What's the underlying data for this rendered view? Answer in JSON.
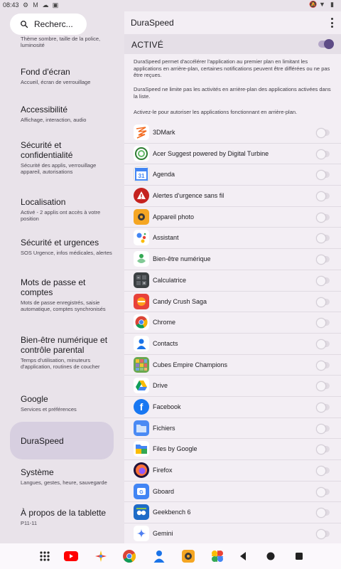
{
  "status_bar": {
    "time": "08:43",
    "left_icons": [
      "gear-icon",
      "gmail-icon",
      "cloud-icon",
      "image-icon"
    ],
    "right_icons": [
      "mute-icon",
      "wifi-icon",
      "battery-icon"
    ]
  },
  "search": {
    "placeholder": "Recherc..."
  },
  "categories": [
    {
      "title": "",
      "sub": "Thème sombre, taille de la police, luminosité"
    },
    {
      "title": "Fond d'écran",
      "sub": "Accueil, écran de verrouillage"
    },
    {
      "title": "Accessibilité",
      "sub": "Affichage, interaction, audio"
    },
    {
      "title": "Sécurité et confidentialité",
      "sub": "Sécurité des applis, verrouillage appareil, autorisations"
    },
    {
      "title": "Localisation",
      "sub": "Activé - 2 applis ont accès à votre position"
    },
    {
      "title": "Sécurité et urgences",
      "sub": "SOS Urgence, infos médicales, alertes"
    },
    {
      "title": "Mots de passe et comptes",
      "sub": "Mots de passe enregistrés, saisie automatique, comptes synchronisés"
    },
    {
      "title": "Bien-être numérique et contrôle parental",
      "sub": "Temps d'utilisation, minuteurs d'application, routines de coucher"
    },
    {
      "title": "Google",
      "sub": "Services et préférences"
    },
    {
      "title": "DuraSpeed",
      "sub": ""
    },
    {
      "title": "Système",
      "sub": "Langues, gestes, heure, sauvegarde"
    },
    {
      "title": "À propos de la tablette",
      "sub": "P11-11"
    }
  ],
  "header": {
    "title": "DuraSpeed"
  },
  "master": {
    "label": "ACTIVÉ",
    "state": "on",
    "color": "#5e4c87"
  },
  "descriptions": [
    "DuraSpeed permet d'accélérer l'application au premier plan en limitant les applications en arrière-plan, certaines notifications peuvent être différées ou ne pas être reçues.",
    "DuraSpeed ne limite pas les activités en arrière-plan des applications activées dans la liste.",
    "Activez-le pour autoriser les applications fonctionnant en arrière-plan."
  ],
  "apps": [
    {
      "name": "3DMark",
      "icon": "3dmark-icon",
      "enabled": false
    },
    {
      "name": "Acer Suggest powered by Digital Turbine",
      "icon": "acer-suggest-icon",
      "enabled": false
    },
    {
      "name": "Agenda",
      "icon": "calendar-icon",
      "enabled": false
    },
    {
      "name": "Alertes d'urgence sans fil",
      "icon": "warning-icon",
      "enabled": false
    },
    {
      "name": "Appareil photo",
      "icon": "camera-icon",
      "enabled": false
    },
    {
      "name": "Assistant",
      "icon": "assistant-icon",
      "enabled": false
    },
    {
      "name": "Bien-être numérique",
      "icon": "wellbeing-icon",
      "enabled": false
    },
    {
      "name": "Calculatrice",
      "icon": "calculator-icon",
      "enabled": false
    },
    {
      "name": "Candy Crush Saga",
      "icon": "candy-crush-icon",
      "enabled": false
    },
    {
      "name": "Chrome",
      "icon": "chrome-icon",
      "enabled": false
    },
    {
      "name": "Contacts",
      "icon": "contacts-icon",
      "enabled": false
    },
    {
      "name": "Cubes Empire Champions",
      "icon": "cubes-icon",
      "enabled": false
    },
    {
      "name": "Drive",
      "icon": "drive-icon",
      "enabled": false
    },
    {
      "name": "Facebook",
      "icon": "facebook-icon",
      "enabled": false
    },
    {
      "name": "Fichiers",
      "icon": "folder-icon",
      "enabled": false
    },
    {
      "name": "Files by Google",
      "icon": "files-by-google-icon",
      "enabled": false
    },
    {
      "name": "Firefox",
      "icon": "firefox-icon",
      "enabled": false
    },
    {
      "name": "Gboard",
      "icon": "gboard-icon",
      "enabled": false
    },
    {
      "name": "Geekbench 6",
      "icon": "geekbench-icon",
      "enabled": false
    },
    {
      "name": "Gemini",
      "icon": "gemini-icon",
      "enabled": false
    }
  ],
  "nav_bar": {
    "items": [
      "apps-grid-icon",
      "youtube-icon",
      "photos-pinwheel-icon",
      "chrome-icon",
      "contacts-icon",
      "camera-icon",
      "google-photos-icon",
      "back-icon",
      "home-icon",
      "recents-icon"
    ]
  }
}
